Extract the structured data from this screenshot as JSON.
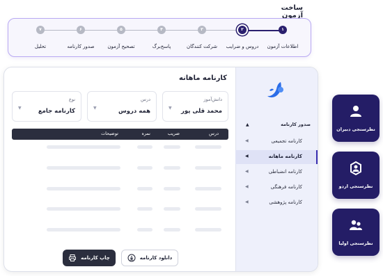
{
  "page": {
    "title": "ساخت آزمون"
  },
  "stepper": {
    "steps": [
      {
        "number": "۱",
        "label": "اطلاعات آزمون",
        "state": "done"
      },
      {
        "number": "۲",
        "label": "دروس و ضرایب",
        "state": "current"
      },
      {
        "number": "۳",
        "label": "شرکت کنندگان",
        "state": "pending"
      },
      {
        "number": "۴",
        "label": "پاسخ‌برگ",
        "state": "pending"
      },
      {
        "number": "۵",
        "label": "تصحیح آزمون",
        "state": "pending"
      },
      {
        "number": "۶",
        "label": "صدور کارنامه",
        "state": "pending"
      },
      {
        "number": "۷",
        "label": "تحلیل",
        "state": "pending"
      }
    ]
  },
  "sidebar": {
    "section_title": "صدور کارنامه",
    "items": [
      {
        "label": "کارنامه تجمیعی",
        "active": false
      },
      {
        "label": "کارنامه ماهانه",
        "active": true
      },
      {
        "label": "کارنامه انضباطی",
        "active": false
      },
      {
        "label": "کارنامه فرهنگی",
        "active": false
      },
      {
        "label": "کارنامه پژوهشی",
        "active": false
      }
    ]
  },
  "content": {
    "title": "کارنامه ماهانه",
    "filters": {
      "student": {
        "label": "دانش‌آموز",
        "value": "محمد قلی پور"
      },
      "course": {
        "label": "درس",
        "value": "همه دروس"
      },
      "type": {
        "label": "نوع",
        "value": "کارنامه جامع"
      }
    },
    "table": {
      "columns": [
        "درس",
        "ضریب",
        "نمره",
        "توضیحات"
      ]
    },
    "buttons": {
      "download": "دانلود کارنامه",
      "print": "چاپ کارنامه"
    }
  },
  "tiles": [
    {
      "label": "نظرسنجی دبیران",
      "icon": "user-icon"
    },
    {
      "label": "نظرسنجی اردو",
      "icon": "group-gear-icon"
    },
    {
      "label": "نظرسنجی اولیا",
      "icon": "parents-icon"
    }
  ],
  "colors": {
    "primary": "#241d66",
    "dark": "#2b2e3e",
    "accent": "#3a2fb0",
    "logo": "#2b6de8",
    "sidebar_bg": "#eef0fb"
  }
}
